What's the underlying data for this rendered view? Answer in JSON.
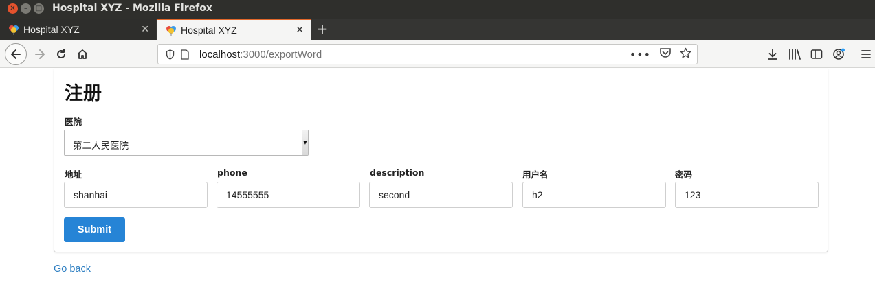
{
  "window": {
    "title": "Hospital XYZ - Mozilla Firefox"
  },
  "tabs": [
    {
      "title": "Hospital XYZ",
      "active": false
    },
    {
      "title": "Hospital XYZ",
      "active": true
    }
  ],
  "address_bar": {
    "host": "localhost",
    "path": ":3000/exportWord"
  },
  "form": {
    "title": "注册",
    "hospital_label": "医院",
    "hospital_selected": "第二人民医院",
    "fields": [
      {
        "label": "地址",
        "value": "shanhai"
      },
      {
        "label": "phone",
        "value": "14555555"
      },
      {
        "label": "description",
        "value": "second"
      },
      {
        "label": "用户名",
        "value": "h2"
      },
      {
        "label": "密码",
        "value": "123"
      }
    ],
    "submit_label": "Submit"
  },
  "go_back_label": "Go back",
  "colors": {
    "accent_tab": "#e2682b",
    "submit_bg": "#2684d6",
    "link": "#2e7fc2"
  }
}
